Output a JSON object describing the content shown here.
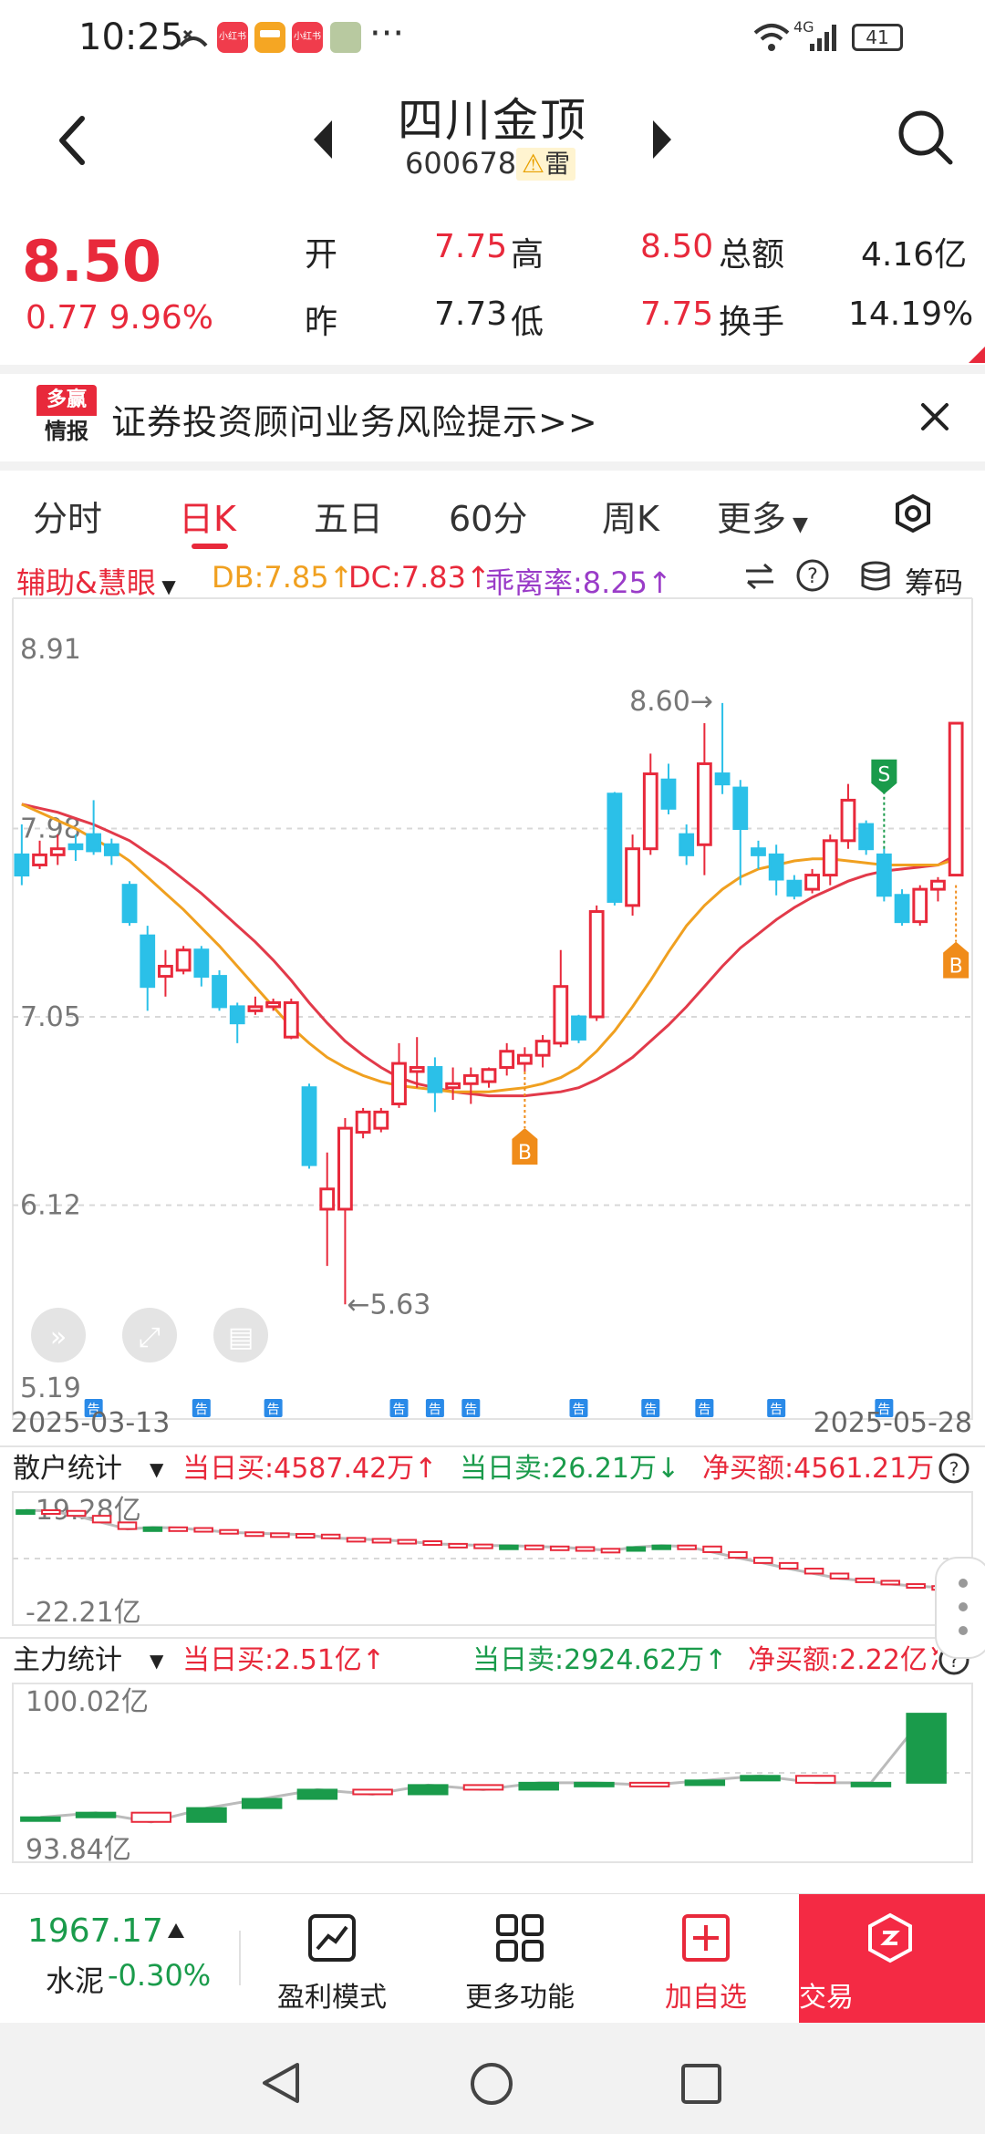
{
  "status_bar": {
    "time": "10:25",
    "network": "4G",
    "battery": "41",
    "app_badge": "小红书"
  },
  "header": {
    "stock_name": "四川金顶",
    "stock_code": "600678",
    "risk_badge": "雷"
  },
  "quote": {
    "price": "8.50",
    "change": "0.77 9.96%",
    "open_label": "开",
    "open_value": "7.75",
    "high_label": "高",
    "high_value": "8.50",
    "amount_label": "总额",
    "amount_value": "4.16亿",
    "prev_label": "昨",
    "prev_value": "7.73",
    "low_label": "低",
    "low_value": "7.75",
    "turnover_label": "换手",
    "turnover_value": "14.19%"
  },
  "banner": {
    "logo_top": "多赢",
    "logo_bottom": "情报",
    "text": "证券投资顾问业务风险提示>>"
  },
  "tabs": [
    "分时",
    "日K",
    "五日",
    "60分",
    "周K",
    "更多"
  ],
  "indicator_bar": {
    "selector": "辅助&慧眼",
    "db": "DB:7.85↑",
    "dc": "DC:7.83↑",
    "bias": "乖离率:8.25↑",
    "chips": "筹码"
  },
  "chart_data": [
    {
      "type": "candlestick",
      "title": "",
      "y_ticks": [
        "8.91",
        "7.98",
        "7.05",
        "6.12",
        "5.19"
      ],
      "ylim": [
        5.19,
        8.91
      ],
      "x_range": [
        "2025-03-13",
        "2025-05-28"
      ],
      "annotations": {
        "high": "8.60→",
        "low": "←5.63",
        "buy_marker": "B",
        "sell_marker": "S",
        "notice_marker": "告"
      },
      "candles": [
        {
          "o": 7.85,
          "h": 8.0,
          "l": 7.7,
          "c": 7.75
        },
        {
          "o": 7.8,
          "h": 7.92,
          "l": 7.78,
          "c": 7.85
        },
        {
          "o": 7.85,
          "h": 7.95,
          "l": 7.8,
          "c": 7.88
        },
        {
          "o": 7.9,
          "h": 7.95,
          "l": 7.82,
          "c": 7.88
        },
        {
          "o": 7.95,
          "h": 8.12,
          "l": 7.85,
          "c": 7.87
        },
        {
          "o": 7.9,
          "h": 7.93,
          "l": 7.8,
          "c": 7.85
        },
        {
          "o": 7.7,
          "h": 7.72,
          "l": 7.5,
          "c": 7.52
        },
        {
          "o": 7.45,
          "h": 7.5,
          "l": 7.08,
          "c": 7.2
        },
        {
          "o": 7.25,
          "h": 7.38,
          "l": 7.15,
          "c": 7.3
        },
        {
          "o": 7.28,
          "h": 7.4,
          "l": 7.26,
          "c": 7.38
        },
        {
          "o": 7.38,
          "h": 7.4,
          "l": 7.2,
          "c": 7.25
        },
        {
          "o": 7.25,
          "h": 7.28,
          "l": 7.08,
          "c": 7.1
        },
        {
          "o": 7.1,
          "h": 7.12,
          "l": 6.92,
          "c": 7.02
        },
        {
          "o": 7.08,
          "h": 7.15,
          "l": 7.06,
          "c": 7.1
        },
        {
          "o": 7.1,
          "h": 7.14,
          "l": 7.08,
          "c": 7.12
        },
        {
          "o": 6.95,
          "h": 7.14,
          "l": 6.94,
          "c": 7.12
        },
        {
          "o": 6.7,
          "h": 6.72,
          "l": 6.3,
          "c": 6.32
        },
        {
          "o": 6.1,
          "h": 6.38,
          "l": 5.82,
          "c": 6.2
        },
        {
          "o": 6.1,
          "h": 6.55,
          "l": 5.63,
          "c": 6.5
        },
        {
          "o": 6.48,
          "h": 6.6,
          "l": 6.45,
          "c": 6.58
        },
        {
          "o": 6.5,
          "h": 6.6,
          "l": 6.48,
          "c": 6.58
        },
        {
          "o": 6.62,
          "h": 6.92,
          "l": 6.6,
          "c": 6.82
        },
        {
          "o": 6.78,
          "h": 6.95,
          "l": 6.7,
          "c": 6.8
        },
        {
          "o": 6.8,
          "h": 6.85,
          "l": 6.58,
          "c": 6.68
        },
        {
          "o": 6.7,
          "h": 6.8,
          "l": 6.64,
          "c": 6.72
        },
        {
          "o": 6.72,
          "h": 6.8,
          "l": 6.62,
          "c": 6.76
        },
        {
          "o": 6.73,
          "h": 6.8,
          "l": 6.7,
          "c": 6.79
        },
        {
          "o": 6.8,
          "h": 6.92,
          "l": 6.76,
          "c": 6.88
        },
        {
          "o": 6.82,
          "h": 6.9,
          "l": 6.78,
          "c": 6.86
        },
        {
          "o": 6.86,
          "h": 6.96,
          "l": 6.8,
          "c": 6.93
        },
        {
          "o": 6.92,
          "h": 7.38,
          "l": 6.9,
          "c": 7.2
        },
        {
          "o": 7.05,
          "h": 7.06,
          "l": 6.92,
          "c": 6.94
        },
        {
          "o": 7.05,
          "h": 7.6,
          "l": 7.03,
          "c": 7.57
        },
        {
          "o": 8.15,
          "h": 8.16,
          "l": 7.6,
          "c": 7.62
        },
        {
          "o": 7.6,
          "h": 7.95,
          "l": 7.55,
          "c": 7.88
        },
        {
          "o": 7.88,
          "h": 8.35,
          "l": 7.85,
          "c": 8.25
        },
        {
          "o": 8.22,
          "h": 8.3,
          "l": 8.05,
          "c": 8.08
        },
        {
          "o": 7.95,
          "h": 8.0,
          "l": 7.8,
          "c": 7.85
        },
        {
          "o": 7.9,
          "h": 8.5,
          "l": 7.75,
          "c": 8.3
        },
        {
          "o": 8.25,
          "h": 8.6,
          "l": 8.15,
          "c": 8.2
        },
        {
          "o": 8.18,
          "h": 8.22,
          "l": 7.7,
          "c": 7.98
        },
        {
          "o": 7.88,
          "h": 7.92,
          "l": 7.78,
          "c": 7.85
        },
        {
          "o": 7.85,
          "h": 7.9,
          "l": 7.65,
          "c": 7.73
        },
        {
          "o": 7.72,
          "h": 7.75,
          "l": 7.63,
          "c": 7.65
        },
        {
          "o": 7.68,
          "h": 7.78,
          "l": 7.66,
          "c": 7.75
        },
        {
          "o": 7.75,
          "h": 7.95,
          "l": 7.7,
          "c": 7.92
        },
        {
          "o": 7.92,
          "h": 8.2,
          "l": 7.88,
          "c": 8.12
        },
        {
          "o": 8.0,
          "h": 8.02,
          "l": 7.85,
          "c": 7.88
        },
        {
          "o": 7.85,
          "h": 7.88,
          "l": 7.62,
          "c": 7.65
        },
        {
          "o": 7.65,
          "h": 7.68,
          "l": 7.5,
          "c": 7.52
        },
        {
          "o": 7.52,
          "h": 7.7,
          "l": 7.5,
          "c": 7.68
        },
        {
          "o": 7.68,
          "h": 7.74,
          "l": 7.62,
          "c": 7.72
        },
        {
          "o": 7.75,
          "h": 8.5,
          "l": 7.75,
          "c": 8.5
        }
      ],
      "series": [
        {
          "name": "DB",
          "color": "#e23a4a",
          "values": [
            8.1,
            8.08,
            8.06,
            8.03,
            8.0,
            7.96,
            7.92,
            7.86,
            7.8,
            7.73,
            7.66,
            7.58,
            7.5,
            7.42,
            7.33,
            7.23,
            7.12,
            7.02,
            6.93,
            6.86,
            6.8,
            6.75,
            6.72,
            6.7,
            6.68,
            6.67,
            6.66,
            6.66,
            6.66,
            6.67,
            6.68,
            6.7,
            6.74,
            6.79,
            6.85,
            6.93,
            7.01,
            7.1,
            7.2,
            7.3,
            7.39,
            7.46,
            7.53,
            7.59,
            7.64,
            7.68,
            7.72,
            7.75,
            7.77,
            7.78,
            7.79,
            7.8,
            7.85
          ]
        },
        {
          "name": "DC",
          "color": "#f0a020",
          "values": [
            8.1,
            8.06,
            8.02,
            7.98,
            7.93,
            7.88,
            7.82,
            7.74,
            7.66,
            7.58,
            7.49,
            7.4,
            7.3,
            7.2,
            7.1,
            7.0,
            6.92,
            6.85,
            6.8,
            6.76,
            6.73,
            6.71,
            6.7,
            6.69,
            6.68,
            6.68,
            6.68,
            6.69,
            6.7,
            6.72,
            6.75,
            6.8,
            6.88,
            6.98,
            7.1,
            7.23,
            7.37,
            7.5,
            7.6,
            7.68,
            7.74,
            7.78,
            7.8,
            7.82,
            7.83,
            7.83,
            7.82,
            7.81,
            7.8,
            7.8,
            7.8,
            7.8,
            7.83
          ]
        }
      ]
    },
    {
      "type": "bar",
      "title": "散户统计",
      "stats": {
        "buy": "当日买:4587.42万↑",
        "sell": "当日卖:26.21万↓",
        "net": "净买额:4561.21万"
      },
      "y_ticks": [
        "-19.28亿",
        "-22.21亿"
      ],
      "ylim": [
        -22.21,
        -19.28
      ],
      "values": [
        -19.28,
        -19.3,
        -19.45,
        -19.65,
        -19.85,
        -19.8,
        -19.82,
        -19.88,
        -19.95,
        -19.98,
        -20.0,
        -20.02,
        -20.12,
        -20.15,
        -20.18,
        -20.22,
        -20.3,
        -20.32,
        -20.35,
        -20.35,
        -20.38,
        -20.4,
        -20.45,
        -20.5,
        -20.4,
        -20.35,
        -20.38,
        -20.55,
        -20.72,
        -20.88,
        -21.05,
        -21.2,
        -21.35,
        -21.42,
        -21.52,
        -21.58,
        -21.62
      ]
    },
    {
      "type": "bar",
      "title": "主力统计",
      "stats": {
        "buy": "当日买:2.51亿↑",
        "sell": "当日卖:2924.62万↑",
        "net": "净买额:2.22亿↑",
        "extra": "净"
      },
      "y_ticks": [
        "100.02亿",
        "93.84亿"
      ],
      "ylim": [
        93.84,
        100.02
      ],
      "values": [
        95.0,
        95.2,
        94.8,
        95.4,
        95.8,
        96.2,
        96.0,
        96.4,
        96.2,
        96.5,
        96.5,
        96.4,
        96.6,
        96.8,
        96.5,
        96.5,
        99.5
      ]
    }
  ],
  "toolbar": {
    "index_value": "1967.17",
    "index_name": "水泥",
    "index_change": "-0.30%",
    "profit_mode": "盈利模式",
    "more_functions": "更多功能",
    "add_watch": "加自选",
    "trade": "交易"
  },
  "colors": {
    "up": "#e8293b",
    "down": "#2bc0e8",
    "green": "#1a9b4b",
    "accent": "#f42a44"
  },
  "icons": [
    "back-icon",
    "prev-stock-icon",
    "next-stock-icon",
    "search-icon",
    "close-icon",
    "settings-icon",
    "swap-icon",
    "help-icon",
    "chips-icon",
    "expand-icon",
    "fullscreen-icon",
    "list-icon",
    "chart-icon",
    "grid-icon",
    "plus-icon",
    "trade-icon"
  ]
}
